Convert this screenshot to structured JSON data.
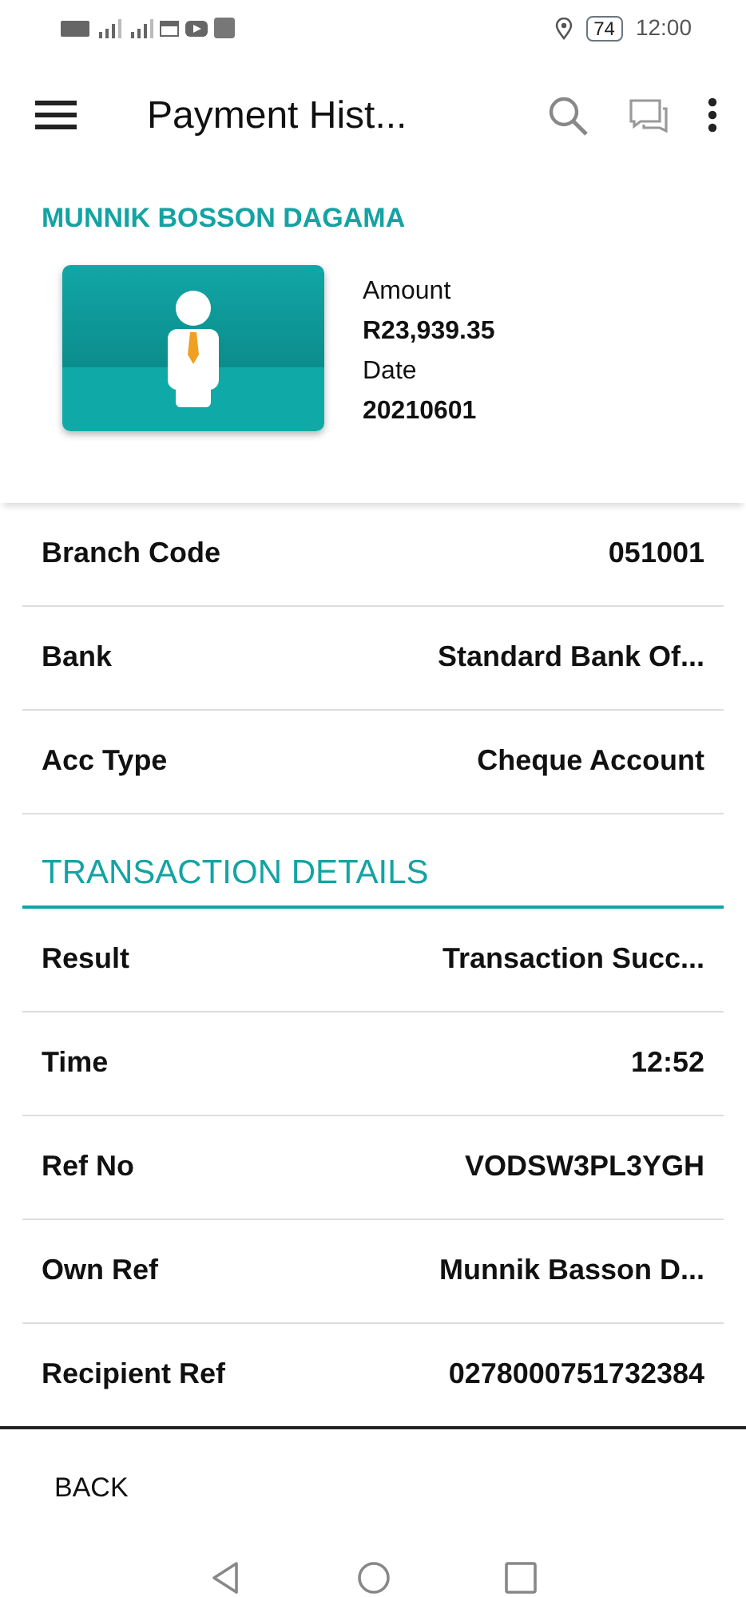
{
  "status_bar": {
    "battery": "74",
    "time": "12:00"
  },
  "toolbar": {
    "title": "Payment Hist..."
  },
  "recipient": {
    "name": "MUNNIK BOSSON DAGAMA",
    "amount_label": "Amount",
    "amount": "R23,939.35",
    "date_label": "Date",
    "date": "20210601"
  },
  "account_rows": [
    {
      "label": "Branch Code",
      "value": "051001"
    },
    {
      "label": "Bank",
      "value": "Standard Bank Of..."
    },
    {
      "label": "Acc Type",
      "value": "Cheque Account"
    }
  ],
  "transaction_section": {
    "title": "TRANSACTION DETAILS"
  },
  "transaction_rows": [
    {
      "label": "Result",
      "value": "Transaction Succ..."
    },
    {
      "label": "Time",
      "value": "12:52"
    },
    {
      "label": "Ref No",
      "value": "VODSW3PL3YGH"
    },
    {
      "label": "Own Ref",
      "value": "Munnik Basson D..."
    },
    {
      "label": "Recipient Ref",
      "value": "0278000751732384"
    }
  ],
  "footer": {
    "button": "BACK"
  }
}
